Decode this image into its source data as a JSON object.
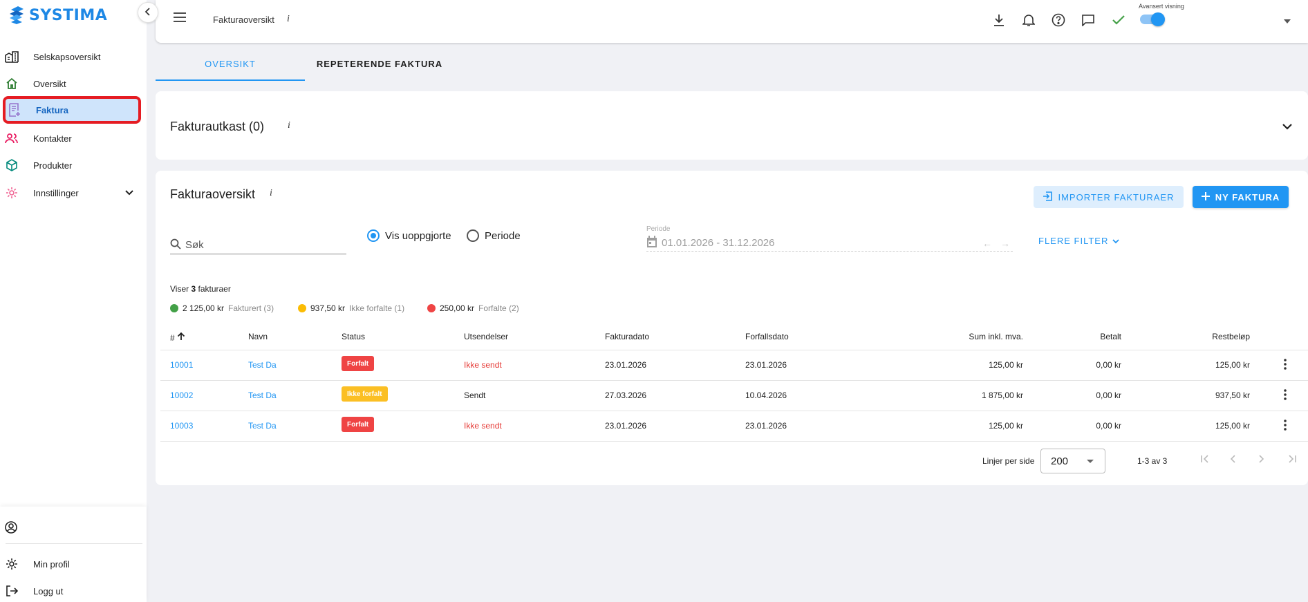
{
  "app": {
    "name": "SYSTIMA"
  },
  "sidebar": {
    "items": [
      {
        "label": "Selskapsoversikt",
        "icon": "building-icon"
      },
      {
        "label": "Oversikt",
        "icon": "home-icon"
      },
      {
        "label": "Faktura",
        "icon": "invoice-icon",
        "active": true
      },
      {
        "label": "Kontakter",
        "icon": "contacts-icon"
      },
      {
        "label": "Produkter",
        "icon": "cube-icon"
      },
      {
        "label": "Innstillinger",
        "icon": "gear-icon"
      }
    ],
    "bottom": [
      {
        "label": "Min profil",
        "icon": "settings-icon"
      },
      {
        "label": "Logg ut",
        "icon": "logout-icon"
      }
    ]
  },
  "topbar": {
    "title": "Fakturaoversikt",
    "info": "i",
    "advanced_label": "Avansert visning",
    "advanced_on": true
  },
  "tabs": [
    {
      "label": "OVERSIKT",
      "active": true
    },
    {
      "label": "REPETERENDE FAKTURA",
      "active": false
    }
  ],
  "draft": {
    "title": "Fakturautkast (0)",
    "info": "i"
  },
  "main": {
    "title": "Fakturaoversikt",
    "info": "i",
    "import_label": "IMPORTER FAKTURAER",
    "new_label": "NY FAKTURA",
    "search_placeholder": "Søk",
    "radio_unpaid": "Vis uoppgjorte",
    "radio_period": "Periode",
    "period_label": "Periode",
    "period_value": "01.01.2026 - 31.12.2026",
    "more_filters": "FLERE FILTER",
    "showing_prefix": "Viser",
    "showing_count": "3",
    "showing_suffix": "fakturaer",
    "summary": [
      {
        "amount": "2 125,00 kr",
        "label": "Fakturert (3)",
        "color": "#43a047"
      },
      {
        "amount": "937,50 kr",
        "label": "Ikke forfalte (1)",
        "color": "#fbbc04"
      },
      {
        "amount": "250,00 kr",
        "label": "Forfalte (2)",
        "color": "#ef4444"
      }
    ]
  },
  "table": {
    "headers": {
      "num": "#",
      "name": "Navn",
      "status": "Status",
      "sendings": "Utsendelser",
      "invoice_date": "Fakturadato",
      "due_date": "Forfallsdato",
      "sum": "Sum inkl. mva.",
      "paid": "Betalt",
      "rest": "Restbeløp"
    },
    "rows": [
      {
        "num": "10001",
        "name": "Test Da",
        "status": "Forfalt",
        "status_color": "red",
        "sending": "Ikke sendt",
        "sending_red": true,
        "invoice_date": "23.01.2026",
        "due_date": "23.01.2026",
        "sum": "125,00 kr",
        "paid": "0,00 kr",
        "rest": "125,00 kr"
      },
      {
        "num": "10002",
        "name": "Test Da",
        "status": "Ikke forfalt",
        "status_color": "yellow",
        "sending": "Sendt",
        "sending_red": false,
        "invoice_date": "27.03.2026",
        "due_date": "10.04.2026",
        "sum": "1 875,00 kr",
        "paid": "0,00 kr",
        "rest": "937,50 kr"
      },
      {
        "num": "10003",
        "name": "Test Da",
        "status": "Forfalt",
        "status_color": "red",
        "sending": "Ikke sendt",
        "sending_red": true,
        "invoice_date": "23.01.2026",
        "due_date": "23.01.2026",
        "sum": "125,00 kr",
        "paid": "0,00 kr",
        "rest": "125,00 kr"
      }
    ]
  },
  "pager": {
    "rows_label": "Linjer per side",
    "rows_value": "200",
    "range": "1-3 av 3"
  }
}
